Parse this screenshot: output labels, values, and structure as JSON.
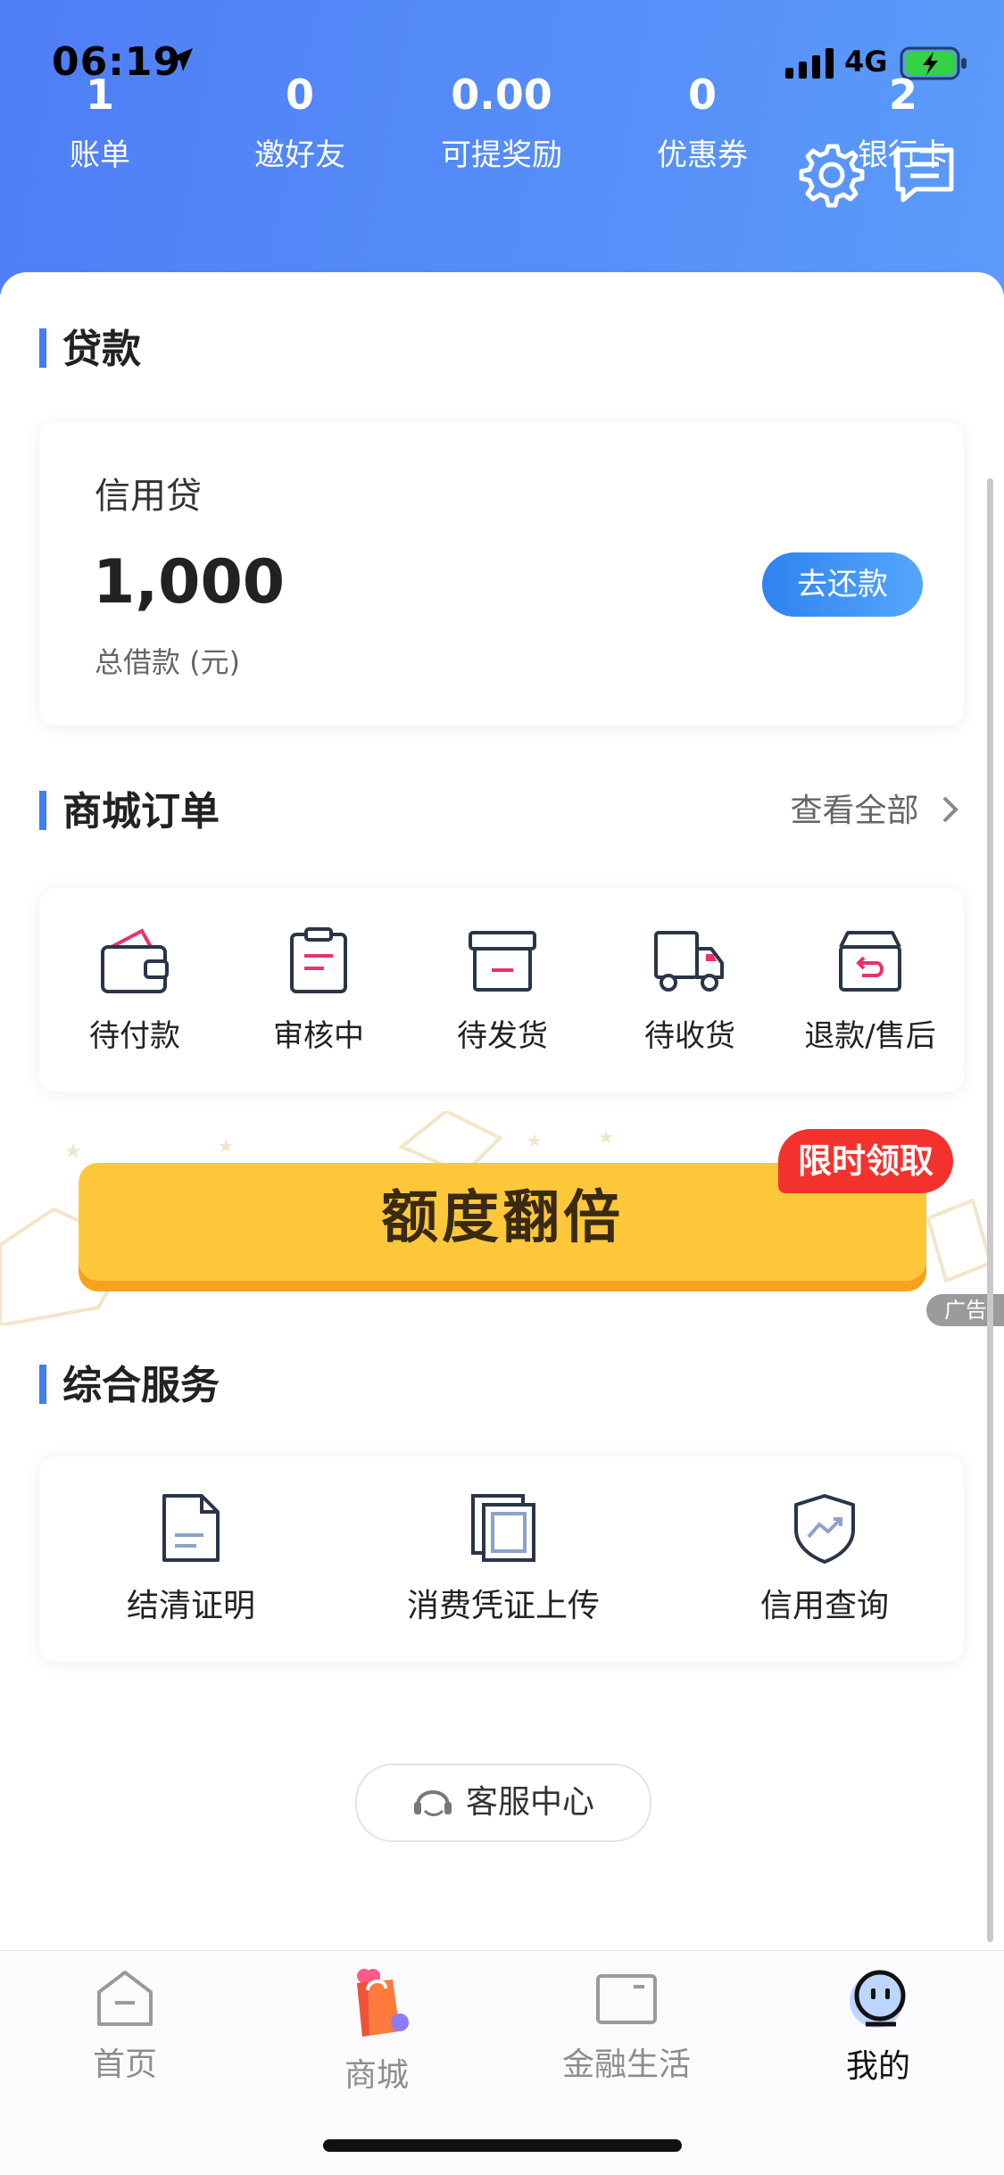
{
  "status_bar": {
    "time": "06:19",
    "network": "4G"
  },
  "stats": [
    {
      "value": "1",
      "label": "账单"
    },
    {
      "value": "0",
      "label": "邀好友"
    },
    {
      "value": "0.00",
      "label": "可提奖励"
    },
    {
      "value": "0",
      "label": "优惠券"
    },
    {
      "value": "2",
      "label": "银行卡"
    }
  ],
  "header_icons": [
    "gear-icon",
    "message-icon"
  ],
  "loan": {
    "section_title": "贷款",
    "product_name": "信用贷",
    "amount": "1,000",
    "amount_label": "总借款 (元)",
    "repay_button": "去还款"
  },
  "orders": {
    "section_title": "商城订单",
    "view_all": "查看全部",
    "items": [
      {
        "label": "待付款",
        "icon": "wallet-icon"
      },
      {
        "label": "审核中",
        "icon": "clipboard-icon"
      },
      {
        "label": "待发货",
        "icon": "box-icon"
      },
      {
        "label": "待收货",
        "icon": "truck-icon"
      },
      {
        "label": "退款/售后",
        "icon": "return-box-icon"
      }
    ]
  },
  "promo": {
    "text": "额度翻倍",
    "tag": "限时领取",
    "ad_label": "广告"
  },
  "services": {
    "section_title": "综合服务",
    "items": [
      {
        "label": "结清证明",
        "icon": "document-icon"
      },
      {
        "label": "消费凭证上传",
        "icon": "copy-icon"
      },
      {
        "label": "信用查询",
        "icon": "shield-icon"
      }
    ]
  },
  "customer_service": {
    "label": "客服中心"
  },
  "tabbar": {
    "items": [
      {
        "label": "首页",
        "icon": "home-icon"
      },
      {
        "label": "商城",
        "icon": "shopping-bag-icon"
      },
      {
        "label": "金融生活",
        "icon": "card-icon"
      },
      {
        "label": "我的",
        "icon": "profile-icon",
        "active": true
      }
    ]
  },
  "colors": {
    "header_start": "#4f7df5",
    "header_end": "#5b9bfb",
    "accent": "#3f7cf5",
    "promo": "#ffc83a",
    "promo_tag": "#f4322d"
  }
}
